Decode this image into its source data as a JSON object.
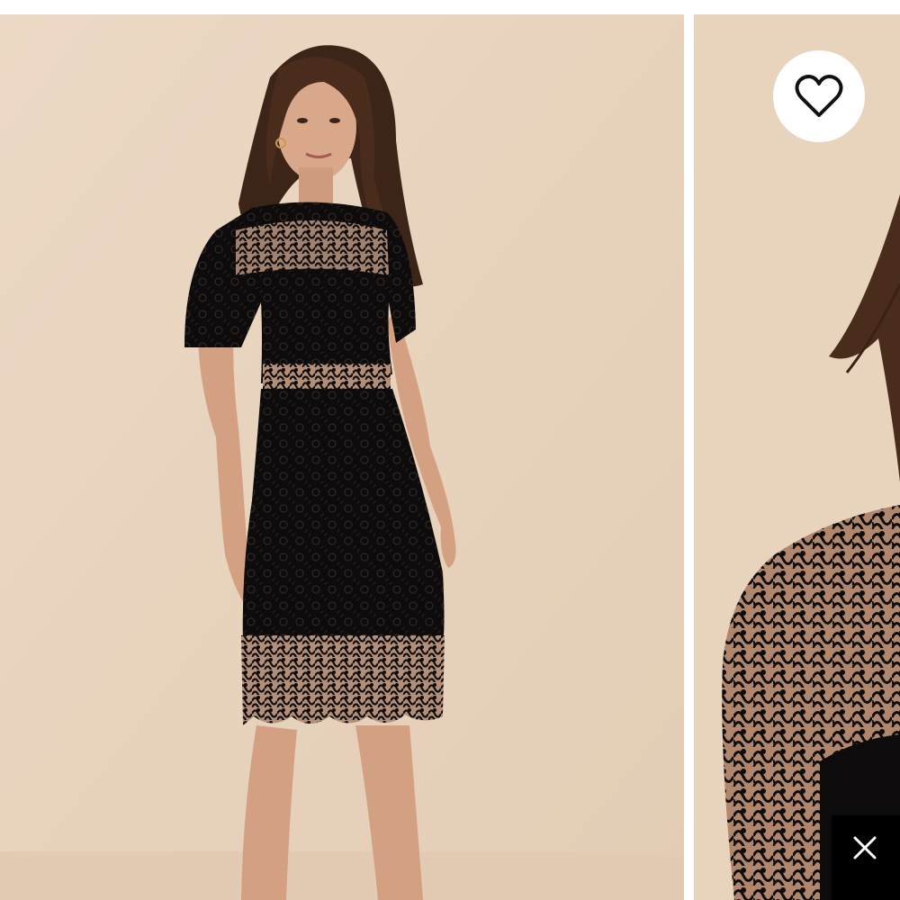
{
  "gallery": {
    "images": [
      {
        "subject": "model-in-black-lace-dress-full-length"
      },
      {
        "subject": "black-lace-sleeve-closeup"
      }
    ]
  },
  "favorite": {
    "icon": "heart-outline-icon"
  },
  "overlay": {
    "icon": "close-icon"
  },
  "colors": {
    "background_beige": "#e9d5c0",
    "dress_black": "#0d0b0b",
    "button_white": "#ffffff",
    "overlay_black": "#000000"
  }
}
